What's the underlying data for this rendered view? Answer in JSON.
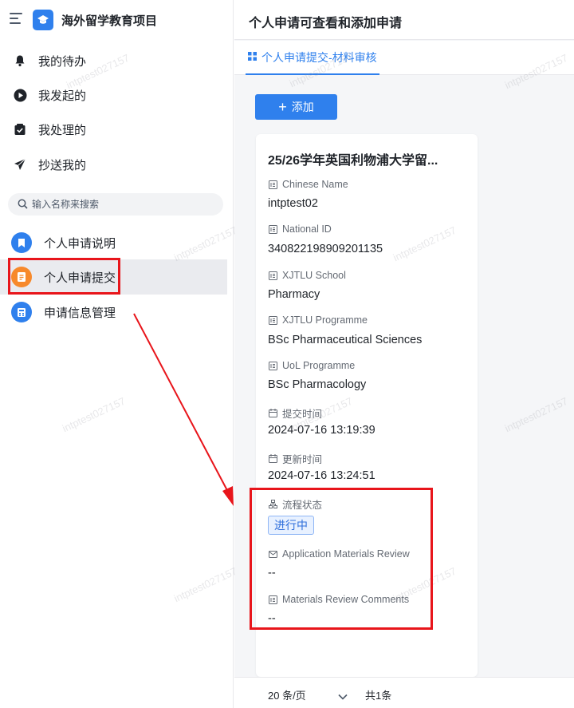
{
  "app": {
    "title": "海外留学教育项目"
  },
  "nav": [
    {
      "label": "我的待办",
      "icon": "bell-icon"
    },
    {
      "label": "我发起的",
      "icon": "play-circle-icon"
    },
    {
      "label": "我处理的",
      "icon": "check-box-icon"
    },
    {
      "label": "抄送我的",
      "icon": "send-icon"
    }
  ],
  "search": {
    "placeholder": "输入名称来搜索"
  },
  "apps": [
    {
      "label": "个人申请说明",
      "icon": "bookmark-icon",
      "color": "#2f80ed"
    },
    {
      "label": "个人申请提交",
      "icon": "document-icon",
      "color": "#f7892b",
      "active": true
    },
    {
      "label": "申请信息管理",
      "icon": "calculator-icon",
      "color": "#2f80ed"
    }
  ],
  "page": {
    "title": "个人申请可查看和添加申请",
    "tab": "个人申请提交-材料审核",
    "add_label": "添加"
  },
  "card": {
    "title": "25/26学年英国利物浦大学留...",
    "fields": [
      {
        "label": "Chinese Name",
        "value": "intptest02"
      },
      {
        "label": "National ID",
        "value": "340822198909201135"
      },
      {
        "label": "XJTLU School",
        "value": "Pharmacy"
      },
      {
        "label": "XJTLU Programme",
        "value": "BSc Pharmaceutical Sciences"
      },
      {
        "label": "UoL Programme",
        "value": "BSc Pharmacology"
      },
      {
        "label": "提交时间",
        "value": "2024-07-16 13:19:39"
      },
      {
        "label": "更新时间",
        "value": "2024-07-16 13:24:51"
      }
    ],
    "status": {
      "label": "流程状态",
      "value": "进行中"
    },
    "review": {
      "label": "Application Materials Review",
      "value": "--"
    },
    "comments": {
      "label": "Materials Review Comments",
      "value": "--"
    }
  },
  "pager": {
    "page_size": "20 条/页",
    "total": "共1条"
  },
  "watermark": "intptest027157",
  "colors": {
    "accent": "#2f80ed",
    "annotation": "#e8151b"
  }
}
